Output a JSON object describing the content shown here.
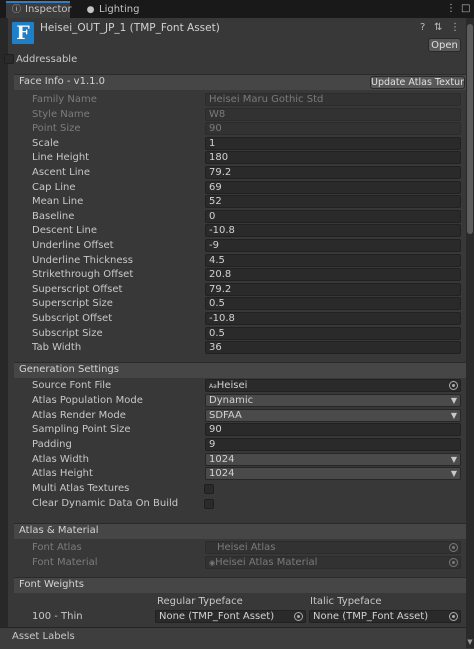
{
  "tabs": [
    {
      "label": "Inspector",
      "icon": "info-icon",
      "active": true
    },
    {
      "label": "Lighting",
      "icon": "lightbulb-icon",
      "active": false
    }
  ],
  "asset": {
    "title": "Heisei_OUT_JP_1 (TMP_Font Asset)",
    "icon_letter": "F",
    "open_label": "Open",
    "addressable_label": "Addressable"
  },
  "face_info": {
    "title": "Face Info - v1.1.0",
    "update_label": "Update Atlas Texture",
    "rows": [
      {
        "label": "Family Name",
        "value": "Heisei Maru Gothic Std",
        "dim": true
      },
      {
        "label": "Style Name",
        "value": "W8",
        "dim": true
      },
      {
        "label": "Point Size",
        "value": "90",
        "dim": true
      },
      {
        "label": "Scale",
        "value": "1"
      },
      {
        "label": "Line Height",
        "value": "180"
      },
      {
        "label": "Ascent Line",
        "value": "79.2"
      },
      {
        "label": "Cap Line",
        "value": "69"
      },
      {
        "label": "Mean Line",
        "value": "52"
      },
      {
        "label": "Baseline",
        "value": "0"
      },
      {
        "label": "Descent Line",
        "value": "-10.8"
      },
      {
        "label": "Underline Offset",
        "value": "-9"
      },
      {
        "label": "Underline Thickness",
        "value": "4.5"
      },
      {
        "label": "Strikethrough Offset",
        "value": "20.8"
      },
      {
        "label": "Superscript Offset",
        "value": "79.2"
      },
      {
        "label": "Superscript Size",
        "value": "0.5"
      },
      {
        "label": "Subscript Offset",
        "value": "-10.8"
      },
      {
        "label": "Subscript Size",
        "value": "0.5"
      },
      {
        "label": "Tab Width",
        "value": "36"
      }
    ]
  },
  "generation": {
    "title": "Generation Settings",
    "source_font_file": {
      "label": "Source Font File",
      "value": "Heisei",
      "value_prefix": "Aa"
    },
    "atlas_population_mode": {
      "label": "Atlas Population Mode",
      "value": "Dynamic"
    },
    "atlas_render_mode": {
      "label": "Atlas Render Mode",
      "value": "SDFAA"
    },
    "sampling_point_size": {
      "label": "Sampling Point Size",
      "value": "90"
    },
    "padding": {
      "label": "Padding",
      "value": "9"
    },
    "atlas_width": {
      "label": "Atlas Width",
      "value": "1024"
    },
    "atlas_height": {
      "label": "Atlas Height",
      "value": "1024"
    },
    "multi_atlas": {
      "label": "Multi Atlas Textures"
    },
    "clear_dynamic": {
      "label": "Clear Dynamic Data On Build"
    }
  },
  "atlas_material": {
    "title": "Atlas & Material",
    "font_atlas": {
      "label": "Font Atlas",
      "value": "Heisei Atlas"
    },
    "font_material": {
      "label": "Font Material",
      "value": "Heisei Atlas Material"
    }
  },
  "font_weights": {
    "title": "Font Weights",
    "regular_header": "Regular Typeface",
    "italic_header": "Italic Typeface",
    "row_label": "100 - Thin",
    "regular_value": "None (TMP_Font Asset)",
    "italic_value": "None (TMP_Font Asset)"
  },
  "asset_labels": "Asset Labels"
}
